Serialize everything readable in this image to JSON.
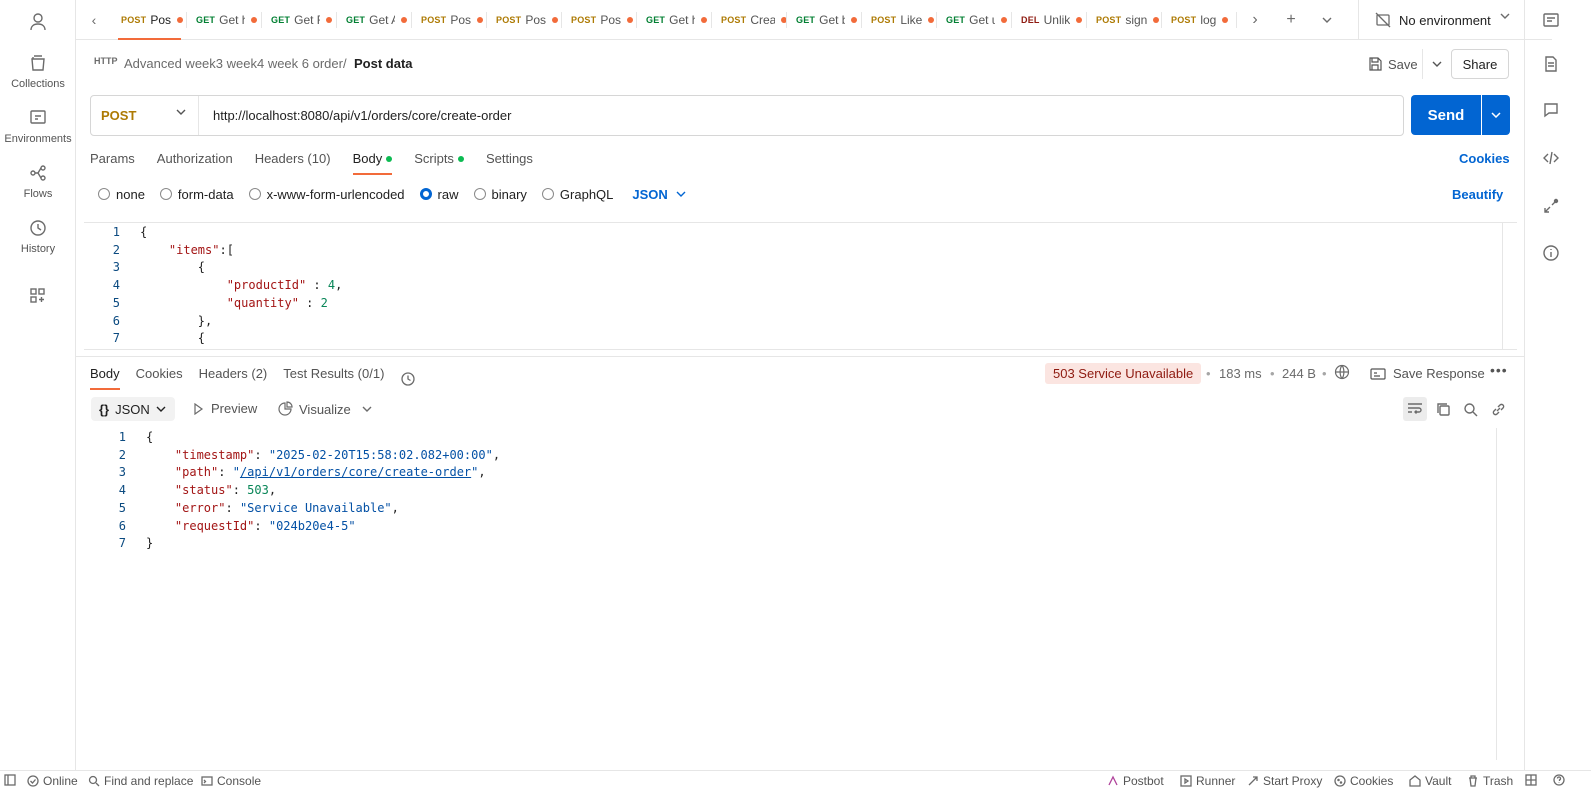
{
  "sidebar": {
    "items": [
      {
        "label": "Collections",
        "icon": "collections-icon"
      },
      {
        "label": "Environments",
        "icon": "environments-icon"
      },
      {
        "label": "Flows",
        "icon": "flows-icon"
      },
      {
        "label": "History",
        "icon": "history-icon"
      }
    ]
  },
  "tabs": [
    {
      "method": "POST",
      "name": "Pos",
      "active": true
    },
    {
      "method": "GET",
      "name": "Get h"
    },
    {
      "method": "GET",
      "name": "Get F"
    },
    {
      "method": "GET",
      "name": "Get A"
    },
    {
      "method": "POST",
      "name": "Pos"
    },
    {
      "method": "POST",
      "name": "Pos"
    },
    {
      "method": "POST",
      "name": "Pos"
    },
    {
      "method": "GET",
      "name": "Get h"
    },
    {
      "method": "POST",
      "name": "Crea"
    },
    {
      "method": "GET",
      "name": "Get b"
    },
    {
      "method": "POST",
      "name": "Like"
    },
    {
      "method": "GET",
      "name": "Get u"
    },
    {
      "method": "DEL",
      "name": "Unlik"
    },
    {
      "method": "POST",
      "name": "sign"
    },
    {
      "method": "POST",
      "name": "log"
    }
  ],
  "environment": {
    "selected": "No environment"
  },
  "breadcrumb": {
    "parent": "Advanced week3 week4 week 6 order",
    "separator": "/",
    "current": "Post data",
    "http_badge": "HTTP"
  },
  "toolbar": {
    "save_label": "Save",
    "share_label": "Share"
  },
  "request": {
    "method": "POST",
    "url": "http://localhost:8080/api/v1/orders/core/create-order",
    "send_label": "Send",
    "tabs": [
      "Params",
      "Authorization",
      "Headers (10)",
      "Body",
      "Scripts",
      "Settings"
    ],
    "cookies_label": "Cookies",
    "body_types": [
      "none",
      "form-data",
      "x-www-form-urlencoded",
      "raw",
      "binary",
      "GraphQL"
    ],
    "body_type_selected": "raw",
    "format": "JSON",
    "beautify_label": "Beautify",
    "lines": [
      [
        [
          "p",
          "{"
        ]
      ],
      [
        [
          "p",
          "    "
        ],
        [
          "k",
          "\"items\""
        ],
        [
          "p",
          ":["
        ]
      ],
      [
        [
          "p",
          "        {"
        ]
      ],
      [
        [
          "p",
          "            "
        ],
        [
          "k",
          "\"productId\""
        ],
        [
          "p",
          " : "
        ],
        [
          "n",
          "4"
        ],
        [
          "p",
          ","
        ]
      ],
      [
        [
          "p",
          "            "
        ],
        [
          "k",
          "\"quantity\""
        ],
        [
          "p",
          " : "
        ],
        [
          "n",
          "2"
        ]
      ],
      [
        [
          "p",
          "        },"
        ]
      ],
      [
        [
          "p",
          "        {"
        ]
      ]
    ]
  },
  "response": {
    "tabs": [
      "Body",
      "Cookies",
      "Headers (2)",
      "Test Results (0/1)"
    ],
    "status": "503 Service Unavailable",
    "time": "183 ms",
    "size": "244 B",
    "save_label": "Save Response",
    "format": "JSON",
    "format_prefix": "{}",
    "preview_label": "Preview",
    "visualize_label": "Visualize",
    "lines": [
      [
        [
          "p",
          "{"
        ]
      ],
      [
        [
          "p",
          "    "
        ],
        [
          "k",
          "\"timestamp\""
        ],
        [
          "p",
          ": "
        ],
        [
          "s",
          "\"2025-02-20T15:58:02.082+00:00\""
        ],
        [
          "p",
          ","
        ]
      ],
      [
        [
          "p",
          "    "
        ],
        [
          "k",
          "\"path\""
        ],
        [
          "p",
          ": "
        ],
        [
          "s",
          "\""
        ],
        [
          "link",
          "/api/v1/orders/core/create-order"
        ],
        [
          "s",
          "\""
        ],
        [
          "p",
          ","
        ]
      ],
      [
        [
          "p",
          "    "
        ],
        [
          "k",
          "\"status\""
        ],
        [
          "p",
          ": "
        ],
        [
          "n",
          "503"
        ],
        [
          "p",
          ","
        ]
      ],
      [
        [
          "p",
          "    "
        ],
        [
          "k",
          "\"error\""
        ],
        [
          "p",
          ": "
        ],
        [
          "s",
          "\"Service Unavailable\""
        ],
        [
          "p",
          ","
        ]
      ],
      [
        [
          "p",
          "    "
        ],
        [
          "k",
          "\"requestId\""
        ],
        [
          "p",
          ": "
        ],
        [
          "s",
          "\"024b20e4-5\""
        ]
      ],
      [
        [
          "p",
          "}"
        ]
      ]
    ]
  },
  "statusbar": {
    "online": "Online",
    "find": "Find and replace",
    "console": "Console",
    "postbot": "Postbot",
    "runner": "Runner",
    "proxy": "Start Proxy",
    "cookies": "Cookies",
    "vault": "Vault",
    "trash": "Trash"
  },
  "colors": {
    "accent": "#f26b3a",
    "primary": "#0265d2",
    "post": "#ad7a03",
    "get": "#007f31",
    "delete": "#8e1a10",
    "error_badge_bg": "#fbe5e1"
  }
}
